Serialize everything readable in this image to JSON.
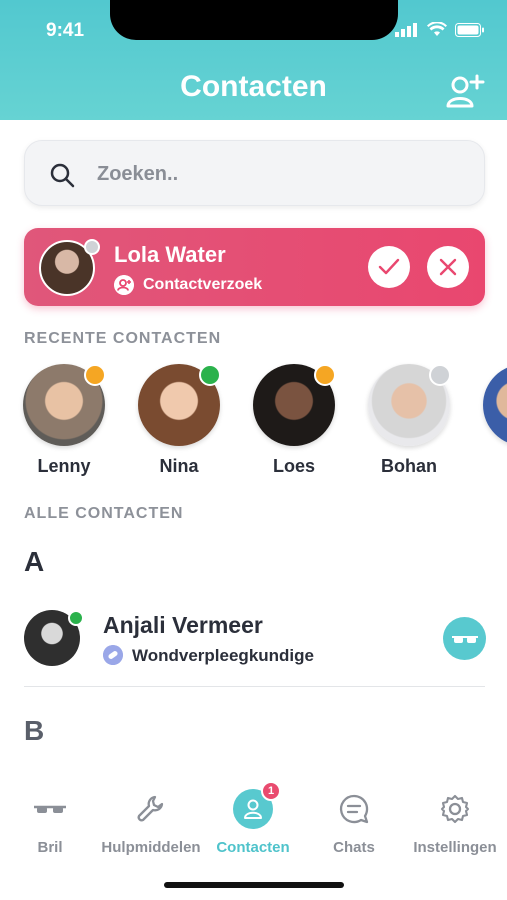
{
  "status": {
    "time": "9:41"
  },
  "header": {
    "title": "Contacten",
    "add_icon": "add-contact-icon"
  },
  "search": {
    "placeholder": "Zoeken..",
    "icon": "search-icon"
  },
  "request": {
    "name": "Lola Water",
    "subtitle": "Contactverzoek",
    "status_color": "#cfd2d6"
  },
  "recent": {
    "label": "RECENTE CONTACTEN",
    "items": [
      {
        "name": "Lenny",
        "status_color": "#f5a623"
      },
      {
        "name": "Nina",
        "status_color": "#2bb24c"
      },
      {
        "name": "Loes",
        "status_color": "#f5a623"
      },
      {
        "name": "Bohan",
        "status_color": "#cfd2d6"
      }
    ]
  },
  "all": {
    "label": "ALLE CONTACTEN",
    "letter_a": "A",
    "letter_b": "B",
    "contact": {
      "name": "Anjali Vermeer",
      "role": "Wondverpleegkundige"
    }
  },
  "tabs": {
    "bril": "Bril",
    "hulpmiddelen": "Hulpmiddelen",
    "contacten": "Contacten",
    "contacten_badge": "1",
    "chats": "Chats",
    "instellingen": "Instellingen"
  },
  "colors": {
    "accent": "#58c9cf",
    "pink": "#e9476f"
  }
}
